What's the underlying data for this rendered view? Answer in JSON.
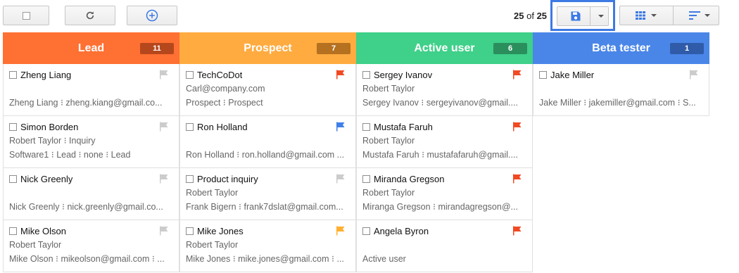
{
  "toolbar": {
    "count_current": "25",
    "count_of": "of",
    "count_total": "25",
    "icons": [
      "checkbox",
      "refresh-icon",
      "add-circle-icon",
      "save-icon",
      "dropdown-caret-icon",
      "grid-view-icon",
      "sort-icon"
    ]
  },
  "colors": {
    "lead": "#ff7033",
    "lead_badge": "#b5471c",
    "prospect": "#ffab40",
    "prospect_badge": "#b57020",
    "active": "#3fd08a",
    "active_badge": "#2a8f5c",
    "beta": "#4a86e8",
    "beta_badge": "#2f5ba8",
    "flag_gray": "#cccccc",
    "flag_red": "#f04a24",
    "flag_blue": "#3f7fe8",
    "flag_orange": "#ffb030",
    "highlight": "#3d7ae3"
  },
  "columns": [
    {
      "title": "Lead",
      "count": "11",
      "cards": [
        {
          "title": "Zheng Liang",
          "line1": "",
          "line2": "Zheng Liang ⁝ zheng.kiang@gmail.co...",
          "flag": "gray"
        },
        {
          "title": "Simon Borden",
          "line1": "Robert Taylor ⁝ Inquiry",
          "line2": "Software1 ⁝ Lead ⁝ none ⁝ Lead",
          "flag": "gray"
        },
        {
          "title": "Nick Greenly",
          "line1": "",
          "line2": "Nick Greenly ⁝ nick.greenly@gmail.co...",
          "flag": "gray"
        },
        {
          "title": "Mike Olson",
          "line1": "Robert Taylor",
          "line2": "Mike Olson ⁝ mikeolson@gmail.com ⁝ ...",
          "flag": "gray"
        }
      ]
    },
    {
      "title": "Prospect",
      "count": "7",
      "cards": [
        {
          "title": "TechCoDot",
          "line1": "Carl@company.com",
          "line2": "Prospect ⁝ Prospect",
          "flag": "red"
        },
        {
          "title": "Ron Holland",
          "line1": "",
          "line2": "Ron Holland ⁝ ron.holland@gmail.com ...",
          "flag": "blue"
        },
        {
          "title": "Product inquiry",
          "line1": "Robert Taylor",
          "line2": "Frank Bigern ⁝ frank7dslat@gmail.com...",
          "flag": "gray"
        },
        {
          "title": "Mike Jones",
          "line1": "Robert Taylor",
          "line2": "Mike Jones ⁝ mike.jones@gmail.com ⁝ ...",
          "flag": "orange"
        }
      ]
    },
    {
      "title": "Active user",
      "count": "6",
      "cards": [
        {
          "title": "Sergey Ivanov",
          "line1": "Robert Taylor",
          "line2": "Sergey Ivanov ⁝ sergeyivanov@gmail....",
          "flag": "red"
        },
        {
          "title": "Mustafa Faruh",
          "line1": "Robert Taylor",
          "line2": "Mustafa Faruh ⁝ mustafafaruh@gmail....",
          "flag": "red"
        },
        {
          "title": "Miranda Gregson",
          "line1": "Robert Taylor",
          "line2": "Miranga Gregson ⁝ mirandagregson@...",
          "flag": "red"
        },
        {
          "title": "Angela Byron",
          "line1": "",
          "line2": "Active user",
          "flag": "red"
        }
      ]
    },
    {
      "title": "Beta tester",
      "count": "1",
      "cards": [
        {
          "title": "Jake Miller",
          "line1": "",
          "line2": "Jake Miller ⁝ jakemiller@gmail.com ⁝ S...",
          "flag": "gray"
        }
      ]
    }
  ]
}
